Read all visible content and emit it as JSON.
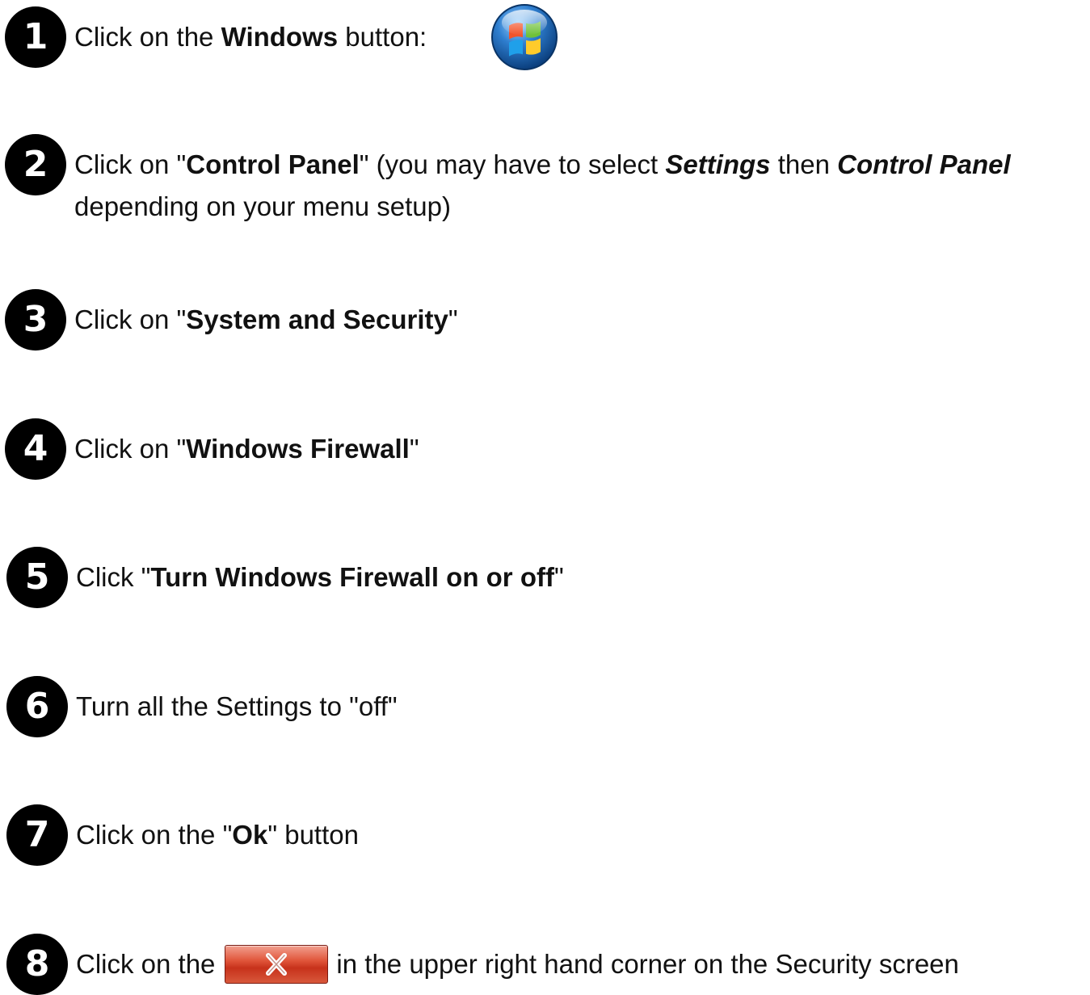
{
  "steps": [
    {
      "number": "1",
      "parts": [
        "Click on the ",
        "Windows",
        " button:"
      ],
      "icon": "windows-start-orb-icon"
    },
    {
      "number": "2",
      "parts": [
        "Click on \"",
        "Control Panel",
        "\" (you may have to select ",
        "Settings",
        " then ",
        "Control Panel",
        " depending on your menu setup)"
      ]
    },
    {
      "number": "3",
      "parts": [
        "Click on \"",
        "System and Security",
        "\""
      ]
    },
    {
      "number": "4",
      "parts": [
        "Click on \"",
        "Windows Firewall",
        "\""
      ]
    },
    {
      "number": "5",
      "parts": [
        "Click \"",
        "Turn Windows Firewall on or off",
        "\""
      ]
    },
    {
      "number": "6",
      "parts": [
        "Turn all the Settings to \"off\""
      ]
    },
    {
      "number": "7",
      "parts": [
        "Click on the \"",
        "Ok",
        "\" button"
      ]
    },
    {
      "number": "8",
      "parts": [
        "Click on the",
        "in the upper right hand corner on the Security screen"
      ],
      "icon": "close-x-button-icon"
    }
  ],
  "colors": {
    "badge": "#000000",
    "text": "#111111",
    "close_button": "#d0452d"
  }
}
